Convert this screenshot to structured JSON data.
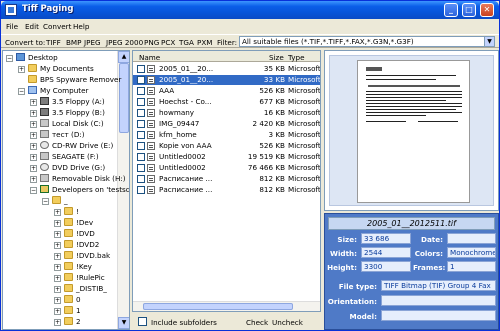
{
  "window": {
    "title": "Tiff Paging",
    "controls": {
      "minimize": "_",
      "maximize": "□",
      "close": "✕"
    }
  },
  "menu": [
    "File",
    "Edit",
    "Convert",
    "Help"
  ],
  "toolbar": {
    "convert_label": "Convert to:",
    "formats": [
      "TIFF",
      "BMP",
      "JPEG",
      "JPEG 2000",
      "PNG",
      "PCX",
      "TGA",
      "PXM"
    ],
    "filter_label": "Filter:",
    "filter_value": "All suitable files (*.TIF,*.TIFF,*.FAX,*.G3N,*.G3F)"
  },
  "tree": [
    {
      "label": "Desktop",
      "icon": "desktop-icon",
      "level": 0,
      "expander": "−"
    },
    {
      "label": "My Documents",
      "icon": "folder-icon",
      "level": 1,
      "expander": "+"
    },
    {
      "label": "BPS Spyware Remover",
      "icon": "folder-icon",
      "level": 1,
      "expander": ""
    },
    {
      "label": "My Computer",
      "icon": "computer-icon",
      "level": 1,
      "expander": "−"
    },
    {
      "label": "3.5 Floppy (A:)",
      "icon": "floppy-icon",
      "level": 2,
      "expander": "+"
    },
    {
      "label": "3.5 Floppy (B:)",
      "icon": "floppy-icon",
      "level": 2,
      "expander": "+"
    },
    {
      "label": "Local Disk (C:)",
      "icon": "drive-icon",
      "level": 2,
      "expander": "+"
    },
    {
      "label": "тест (D:)",
      "icon": "drive-icon",
      "level": 2,
      "expander": "+"
    },
    {
      "label": "CD-RW Drive (E:)",
      "icon": "cd-icon",
      "level": 2,
      "expander": "+"
    },
    {
      "label": "SEAGATE (F:)",
      "icon": "drive-icon",
      "level": 2,
      "expander": "+"
    },
    {
      "label": "DVD Drive (G:)",
      "icon": "cd-icon",
      "level": 2,
      "expander": "+"
    },
    {
      "label": "Removable Disk (H:)",
      "icon": "drive-icon",
      "level": 2,
      "expander": "+"
    },
    {
      "label": "Developers on 'testsqls",
      "icon": "network-drive-icon",
      "level": 2,
      "expander": "−"
    },
    {
      "label": "_",
      "icon": "folder-icon",
      "level": 3,
      "expander": "−"
    },
    {
      "label": "!",
      "icon": "folder-icon",
      "level": 4,
      "expander": "+"
    },
    {
      "label": "!Dev",
      "icon": "folder-icon",
      "level": 4,
      "expander": "+"
    },
    {
      "label": "!DVD",
      "icon": "folder-icon",
      "level": 4,
      "expander": "+"
    },
    {
      "label": "!DVD2",
      "icon": "folder-icon",
      "level": 4,
      "expander": "+"
    },
    {
      "label": "!DVD.bak",
      "icon": "folder-icon",
      "level": 4,
      "expander": "+"
    },
    {
      "label": "!Key",
      "icon": "folder-icon",
      "level": 4,
      "expander": "+"
    },
    {
      "label": "!RulePic",
      "icon": "folder-icon",
      "level": 4,
      "expander": "+"
    },
    {
      "label": "_DISTIB_",
      "icon": "folder-icon",
      "level": 4,
      "expander": "+"
    },
    {
      "label": "0",
      "icon": "folder-icon",
      "level": 4,
      "expander": "+"
    },
    {
      "label": "1",
      "icon": "folder-icon",
      "level": 4,
      "expander": "+"
    },
    {
      "label": "2",
      "icon": "folder-icon",
      "level": 4,
      "expander": "+"
    }
  ],
  "files": {
    "columns": [
      "Name",
      "Size",
      "Type"
    ],
    "rows": [
      {
        "name": "2005_01__20...",
        "size": "35 KB",
        "type": "Microsoft Of",
        "selected": false
      },
      {
        "name": "2005_01__20...",
        "size": "33 KB",
        "type": "Microsoft Of",
        "selected": true
      },
      {
        "name": "AAA",
        "size": "526 KB",
        "type": "Microsoft Of",
        "selected": false
      },
      {
        "name": "Hoechst - Co...",
        "size": "677 KB",
        "type": "Microsoft Of",
        "selected": false
      },
      {
        "name": "howmany",
        "size": "16 KB",
        "type": "Microsoft Of",
        "selected": false
      },
      {
        "name": "IMG_09447",
        "size": "2 420 KB",
        "type": "Microsoft Of",
        "selected": false
      },
      {
        "name": "kfm_home",
        "size": "3 KB",
        "type": "Microsoft Of",
        "selected": false
      },
      {
        "name": "Kopie von AAA",
        "size": "526 KB",
        "type": "Microsoft Of",
        "selected": false
      },
      {
        "name": "Untitled0002",
        "size": "19 519 KB",
        "type": "Microsoft Of",
        "selected": false
      },
      {
        "name": "Untitled0002",
        "size": "76 466 KB",
        "type": "Microsoft Of",
        "selected": false
      },
      {
        "name": "Расписание ...",
        "size": "812 KB",
        "type": "Microsoft Of",
        "selected": false
      },
      {
        "name": "Расписание ...",
        "size": "812 KB",
        "type": "Microsoft Of",
        "selected": false
      }
    ]
  },
  "bottom": {
    "include_subfolders": "Include subfolders",
    "check": "Check",
    "uncheck": "Uncheck"
  },
  "info": {
    "filename": "2005_01__2012511.tif",
    "size_label": "Size:",
    "size": "33 686",
    "date_label": "Date:",
    "date": "",
    "width_label": "Width:",
    "width": "2544",
    "colors_label": "Colors:",
    "colors": "Monochrome",
    "height_label": "Height:",
    "height": "3300",
    "frames_label": "Frames:",
    "frames": "1",
    "filetype_label": "File type:",
    "filetype": "TIFF Bitmap (TIF) Group 4 Fax",
    "orientation_label": "Orientation:",
    "orientation": "",
    "model_label": "Model:",
    "model": ""
  },
  "colors": {
    "titlebar": "#0a5ee8",
    "selection": "#316ac5",
    "info_panel": "#4f7ac7",
    "face": "#ece9d8"
  }
}
